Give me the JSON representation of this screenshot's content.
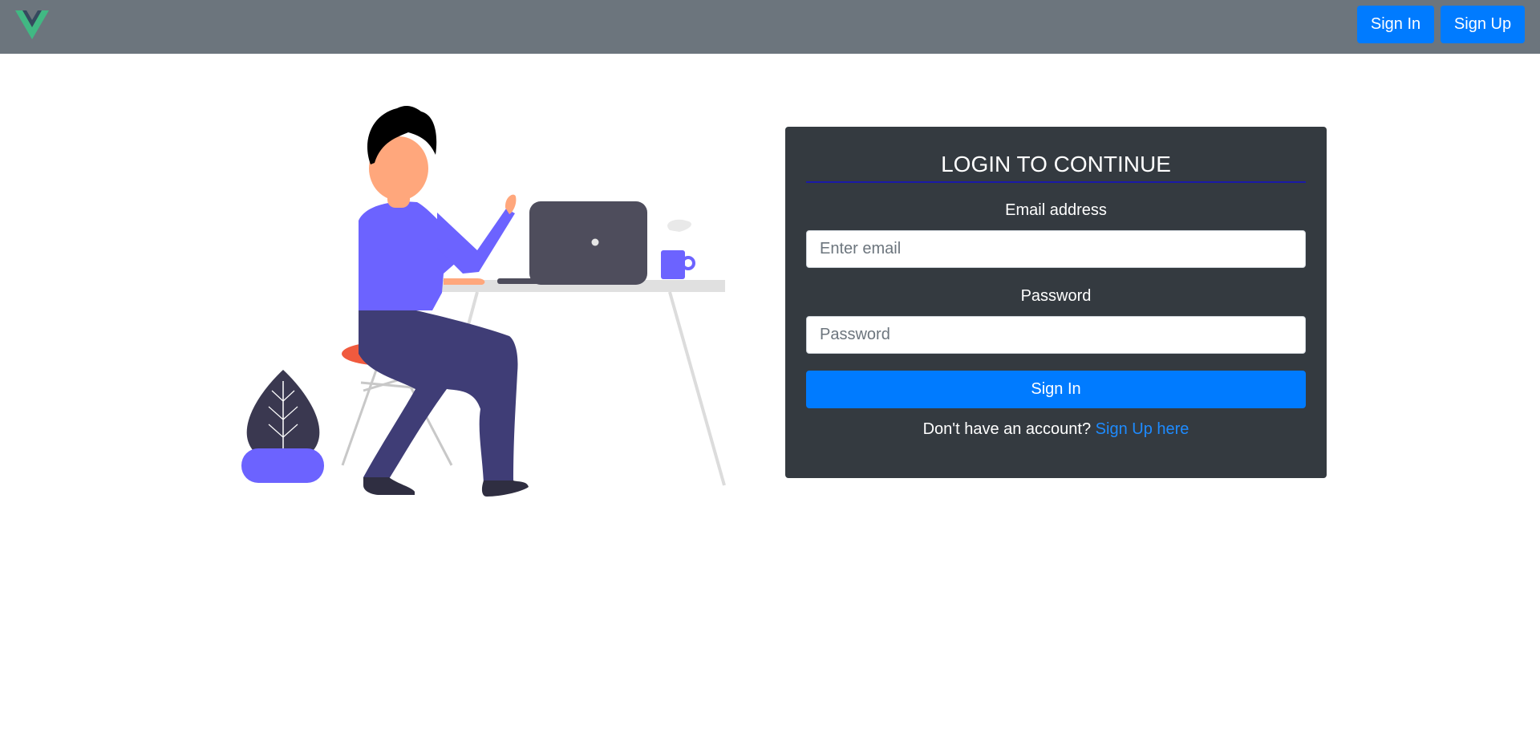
{
  "navbar": {
    "logo_icon": "vue-logo-icon",
    "signin_label": "Sign In",
    "signup_label": "Sign Up",
    "background": "#6c757d",
    "button_color": "#007bff"
  },
  "illustration": {
    "icon": "person-at-desk-illustration",
    "colors": {
      "shirt": "#6c63ff",
      "pants": "#3f3d76",
      "skin": "#ffa77c",
      "hair": "#000000",
      "laptop": "#4e4d5c",
      "stool": "#f05a3e",
      "plant_leaf": "#3a3850",
      "pot": "#6c63ff",
      "desk": "#e0e0e0"
    }
  },
  "login": {
    "title": "LOGIN TO CONTINUE",
    "email_label": "Email address",
    "email_placeholder": "Enter email",
    "email_value": "",
    "password_label": "Password",
    "password_placeholder": "Password",
    "password_value": "",
    "submit_label": "Sign In",
    "signup_prompt": "Don't have an account?",
    "signup_link": "Sign Up here",
    "card_background": "#343a40",
    "accent": "#007bff"
  }
}
